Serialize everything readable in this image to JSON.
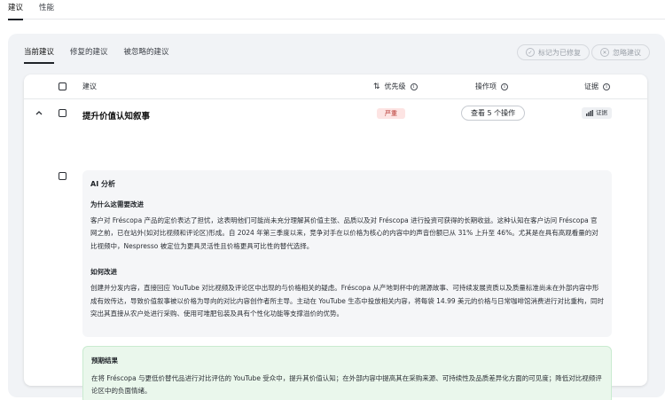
{
  "top_tabs": [
    {
      "label": "建议"
    },
    {
      "label": "性能"
    }
  ],
  "sub_tabs": [
    {
      "label": "当前建议"
    },
    {
      "label": "修复的建议"
    },
    {
      "label": "被忽略的建议"
    }
  ],
  "actions": {
    "mark_fixed": "标记为已修复",
    "ignore": "忽略建议"
  },
  "table": {
    "col_suggestion": "建议",
    "col_priority": "优先级",
    "col_actions": "操作项",
    "col_evidence": "证据"
  },
  "row": {
    "title": "提升价值认知叙事",
    "severity": "严重",
    "view_actions": "查看 5 个操作",
    "evidence": "证据"
  },
  "ai": {
    "title": "AI 分析",
    "why_title": "为什么这需要改进",
    "why_text": "客户对 Fréscopa 产品的定价表达了担忧，这表明他们可能尚未充分理解其价值主张、品质以及对 Fréscopa 进行投资可获得的长期收益。这种认知在客户访问 Fréscopa 官网之前，已在站外(如对比视频和评论区)形成。自 2024 年第三季度以来，竞争对手在以价格为核心的内容中的声音份额已从 31% 上升至 46%。尤其是在具有高观看量的对比视频中，Nespresso 被定位为更具灵活性且价格更具可比性的替代选择。",
    "how_title": "如何改进",
    "how_text": "创建并分发内容，直接回应 YouTube 对比视频及评论区中出现的与价格相关的疑虑。Fréscopa 从产地到杯中的溯源故事、可持续发展资质以及质量标准尚未在外部内容中形成有效传达，导致价值叙事被以价格为导向的对比内容创作者所主导。主动在 YouTube 生态中投放相关内容，将每袋 14.99 美元的价格与日常咖啡馆消费进行对比重构，同时突出其直接从农户处进行采购、使用可堆肥包装及具有个性化功能等支撑溢价的优势。"
  },
  "outcome": {
    "title": "预期结果",
    "text": "在将 Fréscopa 与更低价替代品进行对比评估的 YouTube 受众中，提升其价值认知；在外部内容中提高其在采购来源、可持续性及品质差异化方面的可见度；降低对比视频评论区中的负面情绪。"
  },
  "colors": {
    "severe_bg": "#fde4e3",
    "severe_text": "#b4312b",
    "outcome_bg": "#eaf7ec"
  }
}
